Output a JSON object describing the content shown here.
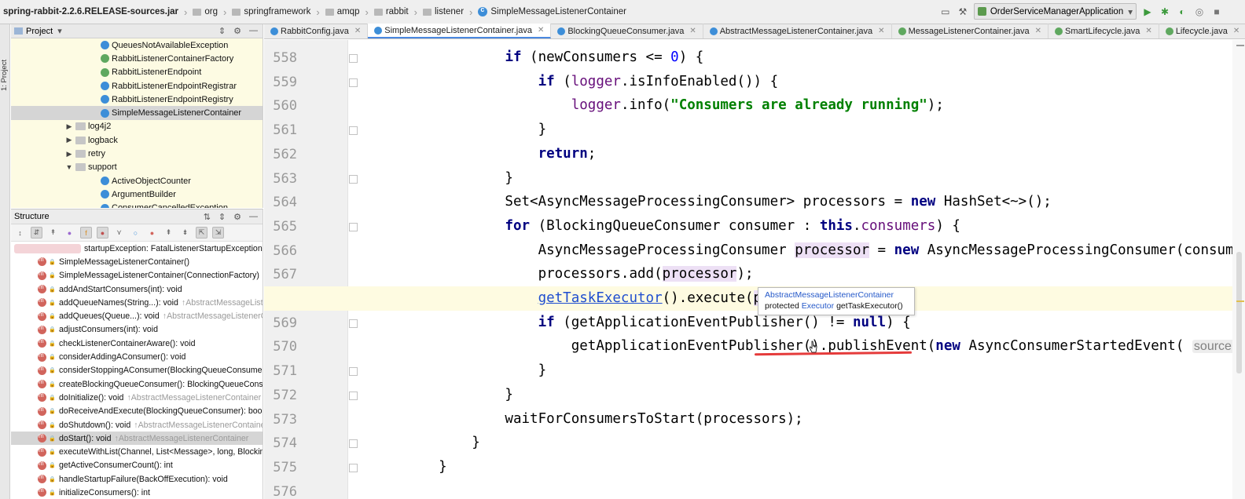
{
  "breadcrumb": [
    "spring-rabbit-2.2.6.RELEASE-sources.jar",
    "org",
    "springframework",
    "amqp",
    "rabbit",
    "listener",
    "SimpleMessageListenerContainer"
  ],
  "run_config": "OrderServiceManagerApplication",
  "side_tabs": {
    "project": "1: Project",
    "structure": "Structure"
  },
  "project_panel": {
    "title": "Project",
    "rows": [
      {
        "label": "QueuesNotAvailableException",
        "kind": "class",
        "indent": 6
      },
      {
        "label": "RabbitListenerContainerFactory",
        "kind": "interface",
        "indent": 6
      },
      {
        "label": "RabbitListenerEndpoint",
        "kind": "interface",
        "indent": 6
      },
      {
        "label": "RabbitListenerEndpointRegistrar",
        "kind": "class",
        "indent": 6
      },
      {
        "label": "RabbitListenerEndpointRegistry",
        "kind": "class",
        "indent": 6
      },
      {
        "label": "SimpleMessageListenerContainer",
        "kind": "class",
        "indent": 6,
        "selected": true
      },
      {
        "label": "log4j2",
        "kind": "package",
        "indent": 4,
        "arrow": "▶"
      },
      {
        "label": "logback",
        "kind": "package",
        "indent": 4,
        "arrow": "▶"
      },
      {
        "label": "retry",
        "kind": "package",
        "indent": 4,
        "arrow": "▶"
      },
      {
        "label": "support",
        "kind": "package",
        "indent": 4,
        "arrow": "▼"
      },
      {
        "label": "ActiveObjectCounter",
        "kind": "class",
        "indent": 6
      },
      {
        "label": "ArgumentBuilder",
        "kind": "class",
        "indent": 6
      },
      {
        "label": "ConsumerCancelledException",
        "kind": "class",
        "indent": 6
      }
    ]
  },
  "structure_panel": {
    "title": "Structure",
    "members": [
      {
        "label": "startupException: FatalListenerStartupException",
        "inherited": "",
        "blurred": true
      },
      {
        "label": "SimpleMessageListenerContainer()",
        "inherited": ""
      },
      {
        "label": "SimpleMessageListenerContainer(ConnectionFactory)",
        "inherited": ""
      },
      {
        "label": "addAndStartConsumers(int): void",
        "inherited": ""
      },
      {
        "label": "addQueueNames(String...): void",
        "inherited": "↑AbstractMessageListenerContainer"
      },
      {
        "label": "addQueues(Queue...): void",
        "inherited": "↑AbstractMessageListenerContainer"
      },
      {
        "label": "adjustConsumers(int): void",
        "inherited": ""
      },
      {
        "label": "checkListenerContainerAware(): void",
        "inherited": ""
      },
      {
        "label": "considerAddingAConsumer(): void",
        "inherited": ""
      },
      {
        "label": "considerStoppingAConsumer(BlockingQueueConsumer): void",
        "inherited": ""
      },
      {
        "label": "createBlockingQueueConsumer(): BlockingQueueConsumer",
        "inherited": ""
      },
      {
        "label": "doInitialize(): void",
        "inherited": "↑AbstractMessageListenerContainer"
      },
      {
        "label": "doReceiveAndExecute(BlockingQueueConsumer): boolean",
        "inherited": ""
      },
      {
        "label": "doShutdown(): void",
        "inherited": "↑AbstractMessageListenerContainer"
      },
      {
        "label": "doStart(): void",
        "inherited": "↑AbstractMessageListenerContainer",
        "selected": true
      },
      {
        "label": "executeWithList(Channel, List<Message>, long, BlockingQueueConsumer)",
        "inherited": ""
      },
      {
        "label": "getActiveConsumerCount(): int",
        "inherited": ""
      },
      {
        "label": "handleStartupFailure(BackOffExecution): void",
        "inherited": ""
      },
      {
        "label": "initializeConsumers(): int",
        "inherited": ""
      }
    ]
  },
  "tabs": [
    {
      "label": "RabbitConfig.java",
      "active": false
    },
    {
      "label": "SimpleMessageListenerContainer.java",
      "active": true
    },
    {
      "label": "BlockingQueueConsumer.java",
      "active": false
    },
    {
      "label": "AbstractMessageListenerContainer.java",
      "active": false
    },
    {
      "label": "MessageListenerContainer.java",
      "active": false
    },
    {
      "label": "SmartLifecycle.java",
      "active": false
    },
    {
      "label": "Lifecycle.java",
      "active": false
    }
  ],
  "editor": {
    "lines": [
      {
        "no": "558",
        "html": "            <span class=\"kw\">if</span> (newConsumers &lt;= <span class=\"num\">0</span>) {"
      },
      {
        "no": "559",
        "html": "                <span class=\"kw\">if</span> (<span class=\"fld\">logger</span>.isInfoEnabled()) {"
      },
      {
        "no": "560",
        "html": "                    <span class=\"fld\">logger</span>.info(<span class=\"str\">\"Consumers are already running\"</span>);"
      },
      {
        "no": "561",
        "html": "                }"
      },
      {
        "no": "562",
        "html": "                <span class=\"kw\">return</span>;"
      },
      {
        "no": "563",
        "html": "            }"
      },
      {
        "no": "564",
        "html": "            Set&lt;AsyncMessageProcessingConsumer&gt; processors = <span class=\"kw\">new</span> HashSet&lt;~&gt;();"
      },
      {
        "no": "565",
        "html": "            <span class=\"kw\">for</span> (BlockingQueueConsumer consumer : <span class=\"kw\">this</span>.<span class=\"fld\">consumers</span>) {"
      },
      {
        "no": "566",
        "html": "                AsyncMessageProcessingConsumer <span class=\"ref\">processor</span> = <span class=\"kw\">new</span> AsyncMessageProcessingConsumer(consumer);"
      },
      {
        "no": "567",
        "html": "                processors.add(<span class=\"ref\">processor</span>);"
      },
      {
        "no": "568",
        "html": "                <span class=\"link\">getTaskExecutor</span>().execute(<span class=\"ref\">processor</span>);",
        "highlight": true
      },
      {
        "no": "569",
        "html": "                <span class=\"kw\">if</span> (getApplicationEventPublisher() != <span class=\"kw\">null</span>) {"
      },
      {
        "no": "570",
        "html": "                    getApplicationEventPublisher().publishEvent(<span class=\"kw\">new</span> AsyncConsumerStartedEvent( <span class=\"param\">source:</span> this, consumer));"
      },
      {
        "no": "571",
        "html": "                }"
      },
      {
        "no": "572",
        "html": "            }"
      },
      {
        "no": "573",
        "html": "            waitForConsumersToStart(processors);"
      },
      {
        "no": "574",
        "html": "        }"
      },
      {
        "no": "575",
        "html": "    }"
      },
      {
        "no": "576",
        "html": ""
      }
    ]
  },
  "tooltip": {
    "owner": "AbstractMessageListenerContainer",
    "modifier": "protected",
    "type": "Executor",
    "signature": "getTaskExecutor()"
  }
}
